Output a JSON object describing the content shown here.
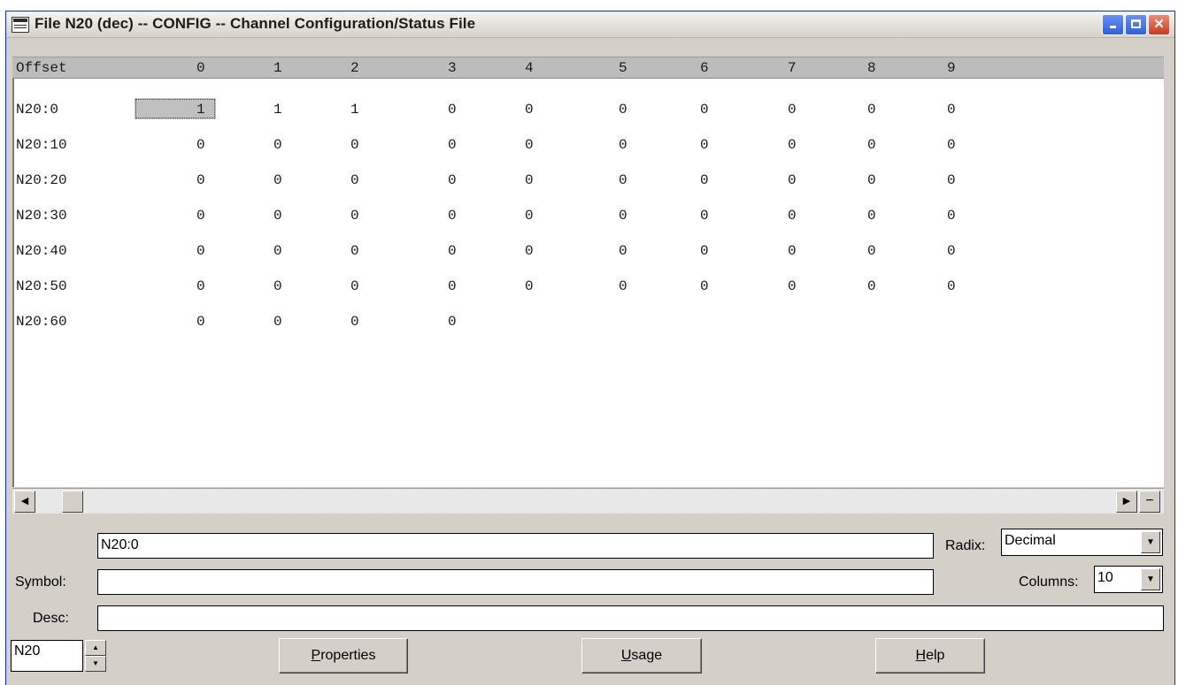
{
  "window": {
    "title": "File N20 (dec)  --  CONFIG  --  Channel Configuration/Status File",
    "buttons": {
      "minimize": "_",
      "maximize": "□",
      "close": "✕"
    }
  },
  "grid": {
    "header": [
      "Offset",
      "0",
      "1",
      "2",
      "3",
      "4",
      "5",
      "6",
      "7",
      "8",
      "9"
    ],
    "rows": [
      {
        "offset": "N20:0",
        "values": [
          "1",
          "1",
          "1",
          "0",
          "0",
          "0",
          "0",
          "0",
          "0",
          "0"
        ]
      },
      {
        "offset": "N20:10",
        "values": [
          "0",
          "0",
          "0",
          "0",
          "0",
          "0",
          "0",
          "0",
          "0",
          "0"
        ]
      },
      {
        "offset": "N20:20",
        "values": [
          "0",
          "0",
          "0",
          "0",
          "0",
          "0",
          "0",
          "0",
          "0",
          "0"
        ]
      },
      {
        "offset": "N20:30",
        "values": [
          "0",
          "0",
          "0",
          "0",
          "0",
          "0",
          "0",
          "0",
          "0",
          "0"
        ]
      },
      {
        "offset": "N20:40",
        "values": [
          "0",
          "0",
          "0",
          "0",
          "0",
          "0",
          "0",
          "0",
          "0",
          "0"
        ]
      },
      {
        "offset": "N20:50",
        "values": [
          "0",
          "0",
          "0",
          "0",
          "0",
          "0",
          "0",
          "0",
          "0",
          "0"
        ]
      },
      {
        "offset": "N20:60",
        "values": [
          "0",
          "0",
          "0",
          "0"
        ]
      }
    ],
    "selected_cell": "N20:0"
  },
  "scrollbar": {
    "left_arrow": "◀",
    "right_arrow": "▶",
    "collapse": "−"
  },
  "address": {
    "value": "N20:0"
  },
  "radix": {
    "label": "Radix:",
    "value": "Decimal"
  },
  "symbol": {
    "label": "Symbol:",
    "value": ""
  },
  "columns": {
    "label": "Columns:",
    "value": "10"
  },
  "desc": {
    "label": "Desc:",
    "value": ""
  },
  "file_selector": {
    "value": "N20"
  },
  "buttons": {
    "properties": "Properties",
    "usage": "Usage",
    "help": "Help"
  }
}
